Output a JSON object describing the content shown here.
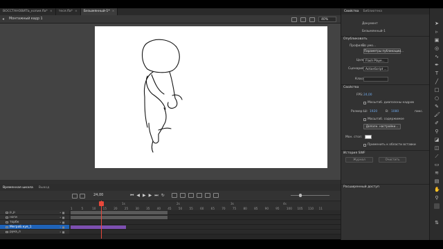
{
  "document_tabs": [
    {
      "label": "ВОССТАНОВИТЬ_копия.fla*",
      "active": false
    },
    {
      "label": "теся.fla*",
      "active": false
    },
    {
      "label": "Безымянный-1*",
      "active": true
    }
  ],
  "scene": {
    "label": "Монтажный кадр 1",
    "zoom": "40%"
  },
  "timeline": {
    "tabs": [
      "Временная шкала",
      "Вывод"
    ],
    "fps": "24,00",
    "frame_ticks": [
      "1",
      "5",
      "10",
      "15",
      "20",
      "25",
      "30",
      "35",
      "40",
      "45",
      "50",
      "55",
      "60",
      "65",
      "70",
      "75",
      "80",
      "85",
      "90",
      "95",
      "100",
      "105",
      "110",
      "11"
    ],
    "second_marks": [
      "1s",
      "2s",
      "3s",
      "4s"
    ],
    "layers": [
      {
        "name": "р_р",
        "selected": false
      },
      {
        "name": "ноги",
        "selected": false
      },
      {
        "name": "торбк",
        "selected": false
      },
      {
        "name": "МеграБ.куя_1",
        "selected": true
      },
      {
        "name": "рука_л",
        "selected": false
      }
    ]
  },
  "panel": {
    "tabs": [
      "Свойства",
      "Библиотека"
    ],
    "doc_label": "Документ",
    "doc_name": "Безымянный-1",
    "publish_section": "Опубликовать",
    "profile_label": "Профиль:",
    "profile_value": "По умо...",
    "publish_params_button": "Параметры публикации...",
    "target_label": "Цель:",
    "target_value": "Flash Playe...",
    "script_label": "Сценарий:",
    "script_value": "ActionScript ...",
    "class_label": "Класс:",
    "props_section": "Свойства",
    "fps_label": "FPS:",
    "fps_value": "24,00",
    "scale_spans": "Масштаб. диапазоны кадров",
    "size_label": "Размер:",
    "width_label": "Ш:",
    "width_value": "1920",
    "height_label": "В:",
    "height_value": "1080",
    "units": "пикс.",
    "scale_content": "Масштаб. содержимое",
    "more_settings_button": "Дополн. настройки...",
    "stage_label": "Мон. стол:",
    "apply_paste": "Применить к области вставки",
    "history_section": "История SWF",
    "log_button": "Журнал",
    "clear_button": "Очистить",
    "access_section": "Расширенный доступ"
  }
}
